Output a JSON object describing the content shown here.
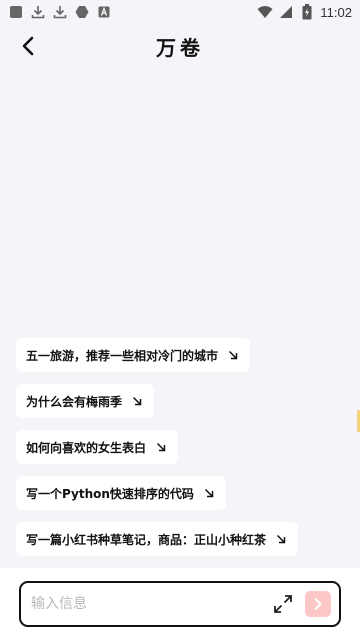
{
  "status_bar": {
    "time": "11:02",
    "left_icons": [
      "app-square-icon",
      "download-icon",
      "download-icon",
      "hexagon-icon",
      "letter-a-icon"
    ],
    "right_icons": [
      "wifi-icon",
      "cellular-signal-icon",
      "battery-charging-icon"
    ]
  },
  "header": {
    "title": "万卷",
    "back_icon": "chevron-left-icon"
  },
  "suggestions": [
    {
      "label": "五一旅游，推荐一些相对冷门的城市",
      "icon": "arrow-down-right-icon"
    },
    {
      "label": "为什么会有梅雨季",
      "icon": "arrow-down-right-icon"
    },
    {
      "label": "如何向喜欢的女生表白",
      "icon": "arrow-down-right-icon"
    },
    {
      "label": "写一个Python快速排序的代码",
      "icon": "arrow-down-right-icon"
    },
    {
      "label": "写一篇小红书种草笔记，商品：正山小种红茶",
      "icon": "arrow-down-right-icon"
    }
  ],
  "input": {
    "placeholder": "输入信息",
    "value": "",
    "expand_icon": "expand-icon",
    "send_icon": "chevron-right-icon"
  },
  "colors": {
    "background": "#f4f4f9",
    "chip_background": "#ffffff",
    "send_button": "#fcc7c7",
    "input_border": "#111111",
    "edge_handle": "#f2d27a"
  }
}
